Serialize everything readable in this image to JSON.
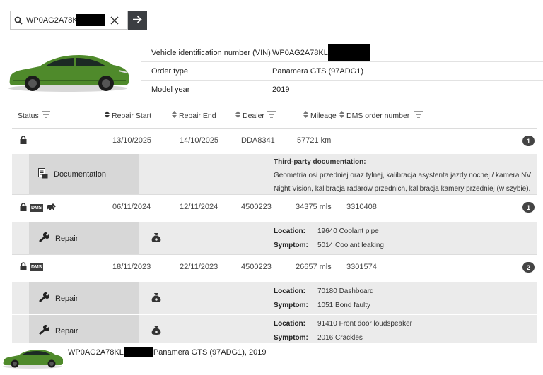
{
  "search": {
    "value": "WP0AG2A78KL",
    "clear_icon": "close-icon",
    "go_icon": "arrow-right-icon",
    "search_icon": "search-icon"
  },
  "vehicle": {
    "vin_label": "Vehicle identification number (VIN)",
    "vin_value": "WP0AG2A78KL",
    "order_type_label": "Order type",
    "order_type_value": "Panamera GTS (97ADG1)",
    "model_year_label": "Model year",
    "model_year_value": "2019",
    "car_color": "#4f8a2b"
  },
  "columns": {
    "status": "Status",
    "repair_start": "Repair Start",
    "repair_end": "Repair End",
    "dealer": "Dealer",
    "mileage": "Mileage",
    "dms_order": "DMS order number"
  },
  "records": [
    {
      "start": "13/10/2025",
      "end": "14/10/2025",
      "dealer": "DDA8341",
      "mileage": "57721 km",
      "dms_order": "",
      "count": "1",
      "icons": [
        "lock-icon"
      ],
      "details": [
        {
          "kind": "Documentation",
          "kind_icon": "document-icon",
          "title": "Third-party documentation:",
          "text": "Geometria osi przedniej oraz tylnej, kalibracja asystenta jazdy nocnej / kamera NV Night Vision, kalibracja radarów przednich, kalibracja kamery przedniej (w szybie)."
        }
      ]
    },
    {
      "start": "06/11/2024",
      "end": "12/11/2024",
      "dealer": "4500223",
      "mileage": "34375 mls",
      "dms_order": "3310408",
      "count": "1",
      "icons": [
        "lock-icon",
        "dms-badge",
        "car-repair-icon"
      ],
      "details": [
        {
          "kind": "Repair",
          "kind_icon": "wrench-icon",
          "mid_icon": "money-bag-icon",
          "location_label": "Location:",
          "location": "19640 Coolant pipe",
          "symptom_label": "Symptom:",
          "symptom": "5014 Coolant leaking"
        }
      ]
    },
    {
      "start": "18/11/2023",
      "end": "22/11/2023",
      "dealer": "4500223",
      "mileage": "26657 mls",
      "dms_order": "3301574",
      "count": "2",
      "icons": [
        "lock-icon",
        "dms-badge"
      ],
      "details": [
        {
          "kind": "Repair",
          "kind_icon": "wrench-icon",
          "mid_icon": "money-bag-icon",
          "location_label": "Location:",
          "location": "70180 Dashboard",
          "symptom_label": "Symptom:",
          "symptom": "1051 Bond faulty"
        },
        {
          "kind": "Repair",
          "kind_icon": "wrench-icon",
          "mid_icon": "money-bag-icon",
          "location_label": "Location:",
          "location": "91410 Front door loudspeaker",
          "symptom_label": "Symptom:",
          "symptom": "2016 Crackles"
        }
      ]
    }
  ],
  "dms_label": "DMS",
  "footer": {
    "vin": "WP0AG2A78KL",
    "summary": "Panamera GTS (97ADG1), 2019"
  }
}
